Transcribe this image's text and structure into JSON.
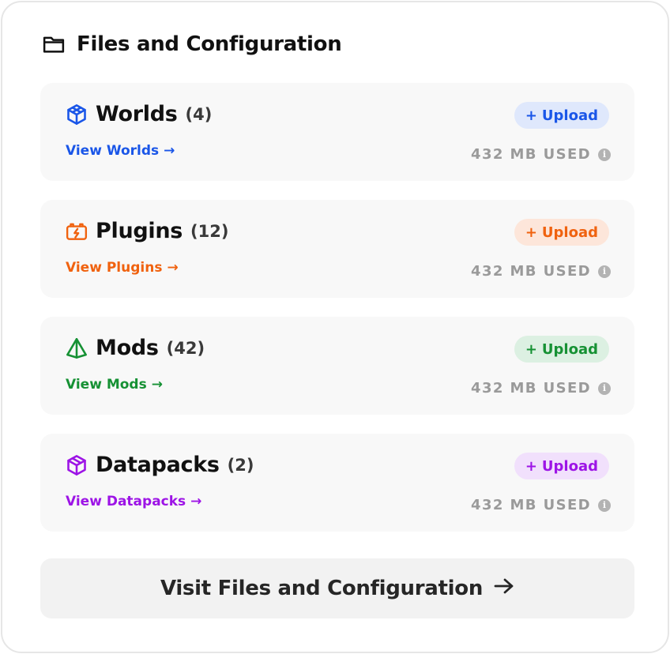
{
  "header": {
    "title": "Files and Configuration",
    "icon": "folder-icon"
  },
  "sections": [
    {
      "key": "worlds",
      "title": "Worlds",
      "count": "(4)",
      "icon": "cube-icon",
      "link": "View Worlds",
      "upload": "Upload",
      "usage": "432 MB USED",
      "color": "#1a56e8",
      "upload_bg": "#dfe8fc"
    },
    {
      "key": "plugins",
      "title": "Plugins",
      "count": "(12)",
      "icon": "battery-bolt-icon",
      "link": "View Plugins",
      "upload": "Upload",
      "usage": "432 MB USED",
      "color": "#f0620f",
      "upload_bg": "#fde6da"
    },
    {
      "key": "mods",
      "title": "Mods",
      "count": "(42)",
      "icon": "pyramid-icon",
      "link": "View Mods",
      "upload": "Upload",
      "usage": "432 MB USED",
      "color": "#169134",
      "upload_bg": "#dcf0e2"
    },
    {
      "key": "datapacks",
      "title": "Datapacks",
      "count": "(2)",
      "icon": "box-icon",
      "link": "View Datapacks",
      "upload": "Upload",
      "usage": "432 MB USED",
      "color": "#9d14e6",
      "upload_bg": "#f1e0fc"
    }
  ],
  "footer": {
    "visit_label": "Visit Files and Configuration"
  }
}
